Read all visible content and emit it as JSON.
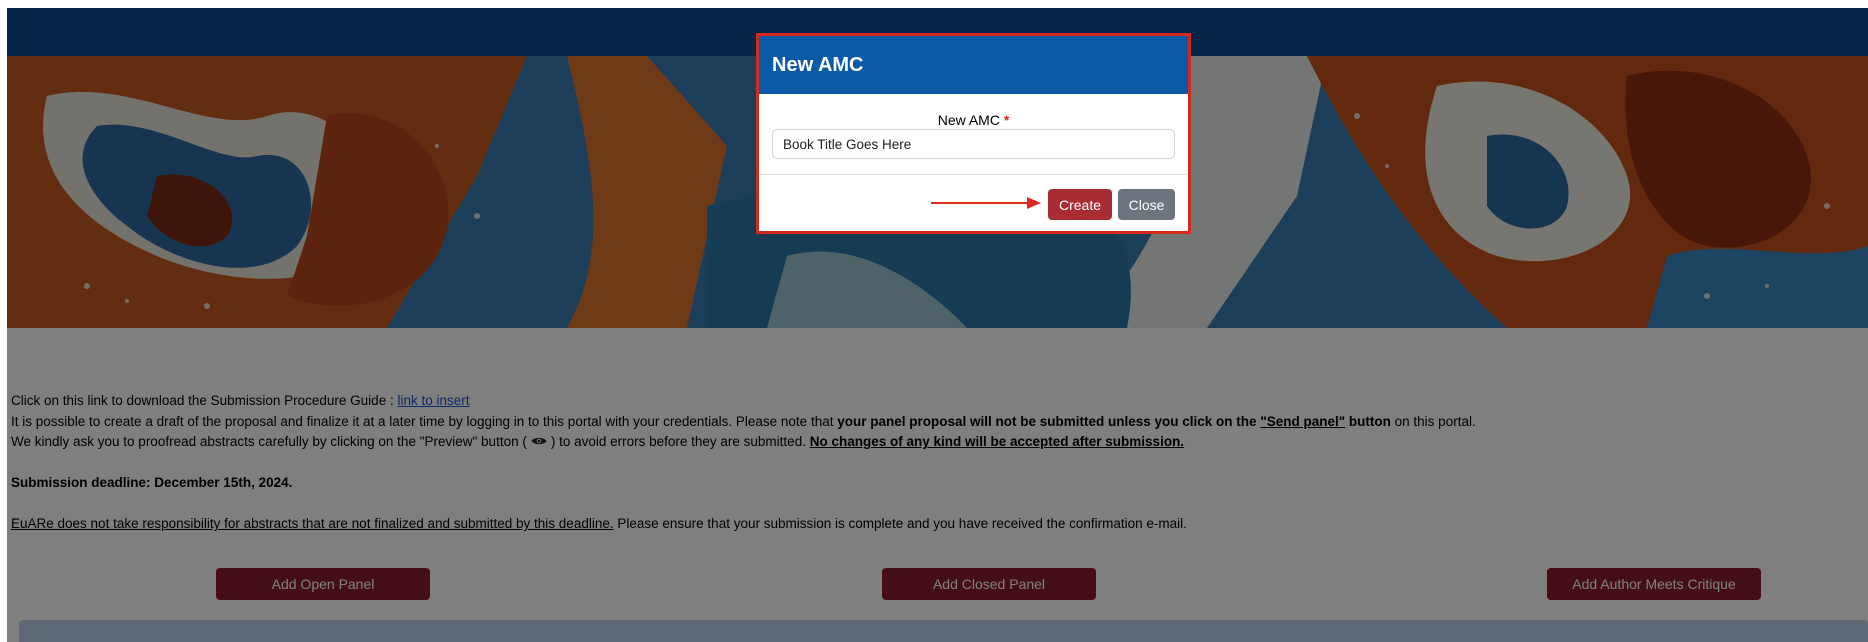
{
  "modal": {
    "title": "New AMC",
    "field_label": "New AMC",
    "required_mark": "*",
    "field_value": "Book Title Goes Here",
    "create_label": "Create",
    "close_label": "Close",
    "border_color": "#d42a1e"
  },
  "content": {
    "line1_prefix": "Click on this link to download the Submission Procedure Guide :",
    "line1_link": "link to insert",
    "line2_a": "It is possible to create a draft of the proposal and finalize it at a later time by logging in to this portal with your credentials. Please note that",
    "line2_b": "your panel proposal will not be submitted unless you click on the",
    "line2_c": "\"Send panel\"",
    "line2_d": "button",
    "line2_e": "on this portal.",
    "line3_a": "We kindly ask you to proofread abstracts carefully by clicking on the \"Preview\" button (",
    "line3_icon": "eye-icon",
    "line3_b": ") to avoid errors before they are submitted.",
    "line3_c": "No changes of any kind will be accepted after submission.",
    "deadline": "Submission deadline: December 15th, 2024.",
    "line5_a": "EuARe does not take responsibility for abstracts that are not finalized and submitted by this deadline.",
    "line5_b": "Please ensure that your submission is complete and you have received the confirmation e-mail."
  },
  "buttons": {
    "open_panel": "Add Open Panel",
    "closed_panel": "Add Closed Panel",
    "amc": "Add Author Meets Critique"
  },
  "colors": {
    "header_blue": "#0a4a8c",
    "panel_button": "#8b1d2c",
    "create_button": "#a72c34",
    "close_button": "#6c757d"
  }
}
